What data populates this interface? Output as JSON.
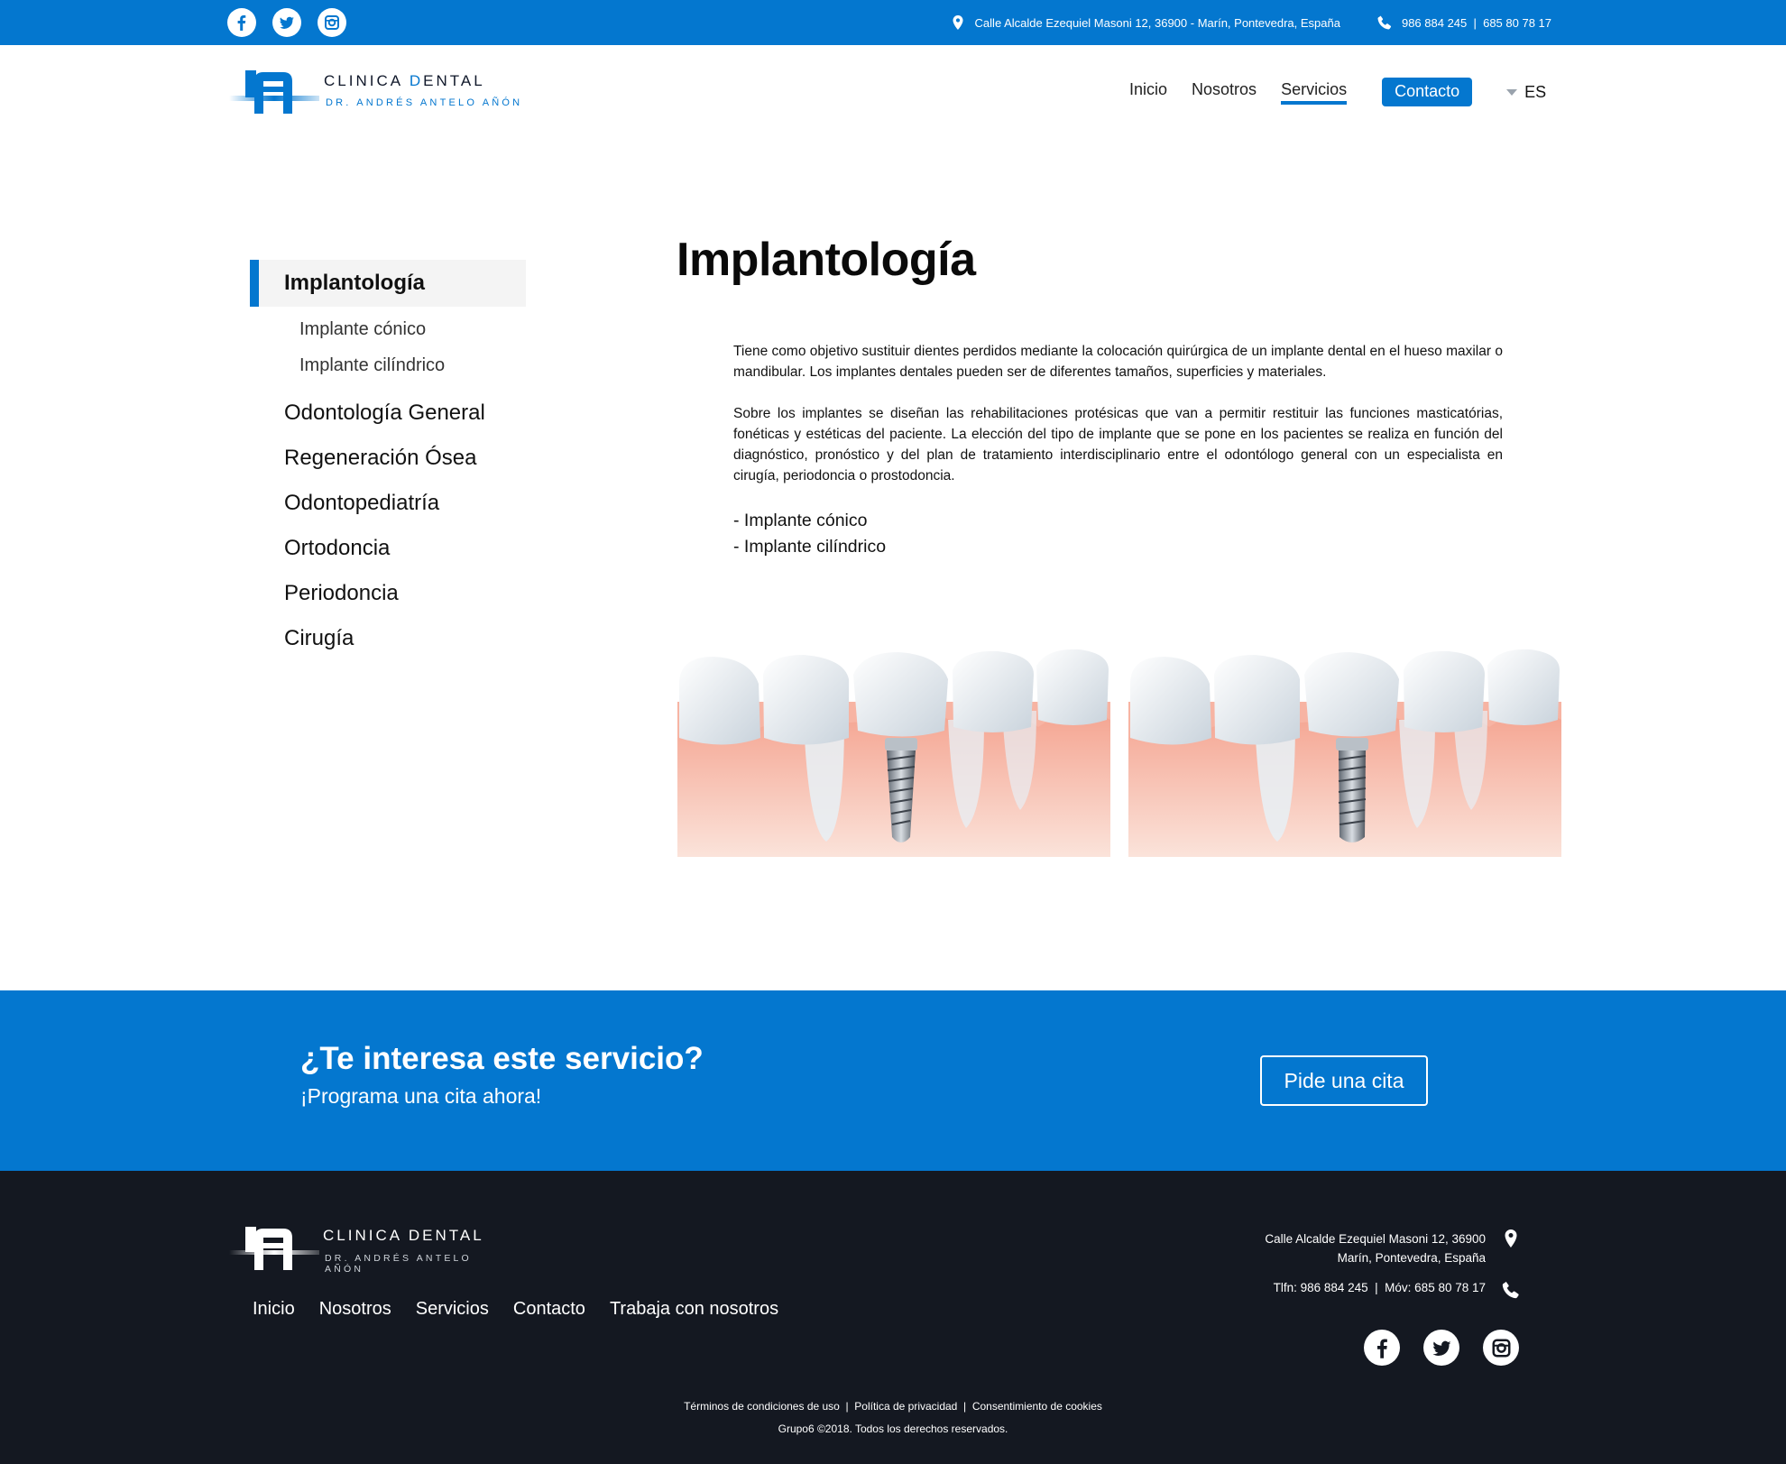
{
  "colors": {
    "brand_blue": "#0477cf",
    "footer_bg": "#141821",
    "white": "#ffffff"
  },
  "topbar": {
    "social_icons": [
      "facebook-icon",
      "twitter-icon",
      "instagram-icon"
    ],
    "address": "Calle Alcalde Ezequiel Masoni 12, 36900 - Marín, Pontevedra, España",
    "phones": "986 884 245  |  685 80 78 17"
  },
  "header": {
    "logo_brand_prefix": "CLINICA ",
    "logo_brand_highlight": "D",
    "logo_brand_suffix": "ENTAL",
    "logo_sub": "DR. ANDRÉS ANTELO AÑÓN",
    "nav": {
      "inicio": "Inicio",
      "nosotros": "Nosotros",
      "servicios": "Servicios",
      "contacto": "Contacto"
    },
    "language": "ES"
  },
  "sidebar": {
    "active": "Implantología",
    "subitems": [
      "Implante cónico",
      "Implante cilíndrico"
    ],
    "items": [
      "Odontología General",
      "Regeneración Ósea",
      "Odontopediatría",
      "Ortodoncia",
      "Periodoncia",
      "Cirugía"
    ]
  },
  "main": {
    "title": "Implantología",
    "paragraph1": "Tiene como objetivo sustituir dientes perdidos mediante la colocación quirúrgica de un implante dental en el hueso maxilar o mandibular. Los implantes dentales pueden ser de diferentes tamaños, superficies y materiales.",
    "paragraph2": "Sobre los implantes se diseñan las rehabilitaciones protésicas que van a permitir restituir las funciones masticatórias, fonéticas y estéticas del paciente. La elección del tipo de implante que se pone en los pacientes se realiza en función del diagnóstico, pronóstico y del plan de tratamiento interdisciplinario entre el odontólogo general con un especialista en cirugía, periodoncia o prostodoncia.",
    "bullets": [
      "- Implante cónico",
      "- Implante cilíndrico"
    ]
  },
  "cta": {
    "question": "¿Te interesa este servicio?",
    "subtitle": "¡Programa una cita ahora!",
    "button": "Pide una cita"
  },
  "footer": {
    "logo_brand": "CLINICA DENTAL",
    "logo_sub": "DR. ANDRÉS ANTELO AÑÓN",
    "nav": [
      "Inicio",
      "Nosotros",
      "Servicios",
      "Contacto",
      "Trabaja con nosotros"
    ],
    "address_line1": "Calle Alcalde Ezequiel Masoni 12, 36900",
    "address_line2": "Marín, Pontevedra, España",
    "phones": "Tlfn: 986 884 245  |  Móv: 685 80 78 17",
    "social_icons": [
      "facebook-icon",
      "twitter-icon",
      "instagram-icon"
    ],
    "legal": "Términos de condiciones de uso  |  Política de privacidad  |  Consentimiento de cookies",
    "copyright": "Grupo6 ©2018. Todos los derechos reservados."
  }
}
